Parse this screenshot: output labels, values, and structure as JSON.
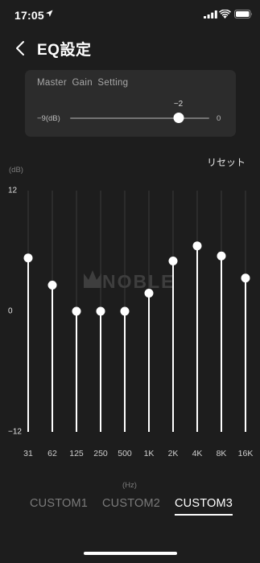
{
  "status_bar": {
    "time": "17:05"
  },
  "header": {
    "title": "EQ設定"
  },
  "master_gain": {
    "title": "Master  Gain  Setting",
    "value_label": "−2",
    "min_label": "−9(dB)",
    "max_label": "0",
    "min": -9,
    "max": 0,
    "value": -2
  },
  "reset_label": "リセット",
  "eq": {
    "y_unit": "(dB)",
    "y_ticks": [
      {
        "label": "12",
        "value": 12
      },
      {
        "label": "0",
        "value": 0
      },
      {
        "label": "−12",
        "value": -12
      }
    ],
    "watermark": "NOBLE",
    "x_unit": "(Hz)"
  },
  "chart_data": {
    "type": "bar",
    "categories": [
      "31",
      "62",
      "125",
      "250",
      "500",
      "1K",
      "2K",
      "4K",
      "8K",
      "16K"
    ],
    "values": [
      5.3,
      2.6,
      0,
      0,
      0,
      1.8,
      5.0,
      6.5,
      5.5,
      3.3
    ],
    "xlabel": "(Hz)",
    "ylabel": "(dB)",
    "ylim": [
      -12,
      12
    ],
    "grid": true
  },
  "presets": {
    "tabs": [
      "CUSTOM1",
      "CUSTOM2",
      "CUSTOM3"
    ],
    "active_index": 2
  },
  "colors": {
    "background": "#1d1d1d",
    "card": "#2c2c2c",
    "slider_line": "#ffffff",
    "grid_line": "#3a3a3a",
    "watermark": "#3e3e3e"
  }
}
